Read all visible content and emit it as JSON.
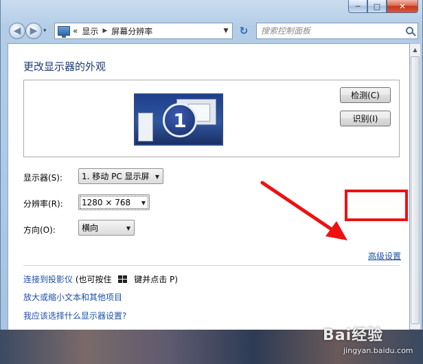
{
  "window": {
    "caption": {
      "min": "─",
      "max": "□",
      "close": "✕"
    }
  },
  "navigation": {
    "back_glyph": "◀",
    "forward_glyph": "▶",
    "address": {
      "overflow": "«",
      "crumb_1": "显示",
      "separator": "▶",
      "crumb_2": "屏幕分辨率",
      "dropdown_glyph": "▼"
    },
    "refresh_glyph": "↻",
    "search_placeholder": "搜索控制面板"
  },
  "main": {
    "title": "更改显示器的外观",
    "preview": {
      "monitor_number": "1"
    },
    "detect_button": "检测(C)",
    "identify_button": "识别(I)",
    "display_label": "显示器(S):",
    "display_value": "1. 移动 PC 显示屏",
    "resolution_label": "分辨率(R):",
    "resolution_value": "1280 × 768",
    "orientation_label": "方向(O):",
    "orientation_value": "横向",
    "advanced_link": "高级设置",
    "projector_link": "连接到投影仪",
    "projector_hint_prefix": "(也可按住",
    "projector_hint_suffix": "键并点击 P)",
    "text_size_link": "放大或缩小文本和其他项目",
    "which_settings_link": "我应该选择什么显示器设置?"
  },
  "colors": {
    "link": "#1e4fa5",
    "title": "#1c3a78",
    "highlight": "#ee1111"
  },
  "watermark": {
    "brand": "Bai经验",
    "url": "jingyan.baidu.com"
  }
}
